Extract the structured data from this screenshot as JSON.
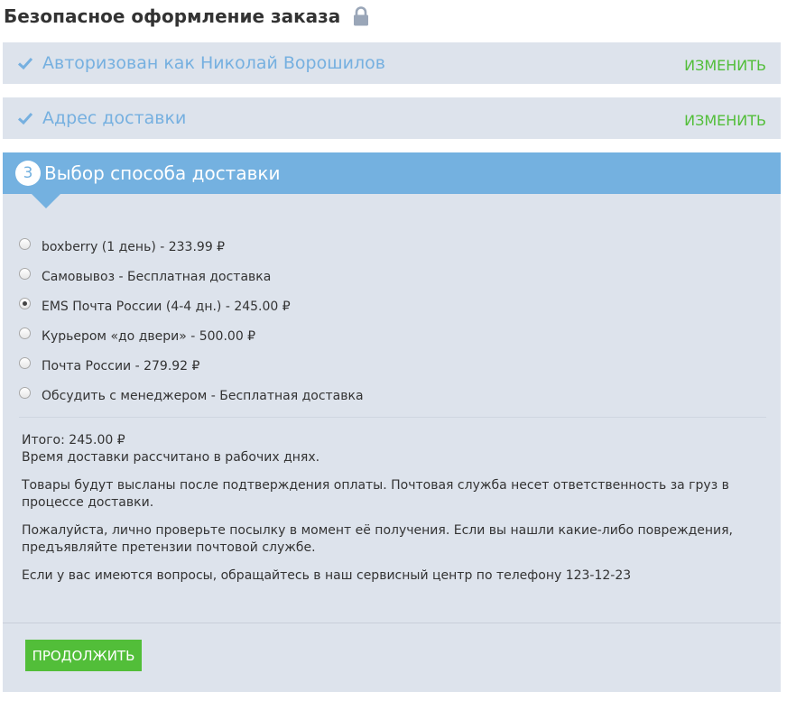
{
  "header": {
    "title": "Безопасное оформление заказа",
    "lock_icon": "lock-icon"
  },
  "steps": [
    {
      "title": "Авторизован как Николай Ворошилов",
      "change_label": "ИЗМЕНИТЬ",
      "status_icon": "check-icon"
    },
    {
      "title": "Адрес доставки",
      "change_label": "ИЗМЕНИТЬ",
      "status_icon": "check-icon"
    }
  ],
  "active_step": {
    "number": "3",
    "title": "Выбор способа доставки",
    "options": [
      {
        "label": "boxberry (1 день) - 233.99 ₽",
        "selected": false
      },
      {
        "label": "Самовывоз - Бесплатная доставка",
        "selected": false
      },
      {
        "label": "EMS Почта России (4-4 дн.) - 245.00 ₽",
        "selected": true
      },
      {
        "label": "Курьером «до двери» - 500.00 ₽",
        "selected": false
      },
      {
        "label": "Почта России - 279.92 ₽",
        "selected": false
      },
      {
        "label": "Обсудить с менеджером - Бесплатная доставка",
        "selected": false
      }
    ],
    "total": "Итого: 245.00 ₽",
    "info": [
      "Время доставки рассчитано в рабочих днях.",
      "Товары будут высланы после подтверждения оплаты. Почтовая служба несет ответственность за груз в процессе доставки.",
      "Пожалуйста, лично проверьте посылку в момент её получения. Если вы нашли какие-либо повреждения, предъявляйте претензии почтовой службе.",
      "Если у вас имеются вопросы, обращайтесь в наш сервисный центр по телефону 123-12-23"
    ],
    "continue_label": "ПРОДОЛЖИТЬ"
  },
  "colors": {
    "accent": "#74b1e0",
    "link": "#52be39",
    "panel": "#dde3ec"
  }
}
